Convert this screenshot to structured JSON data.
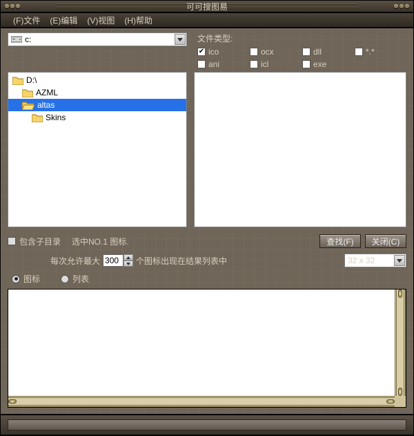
{
  "title": "可可搜图易",
  "menu": {
    "file": "(F)文件",
    "edit": "(E)编辑",
    "view": "(V)视图",
    "help": "(H)帮助"
  },
  "drive": {
    "selected": "c:"
  },
  "filetype": {
    "label": "文件类型:",
    "items": [
      {
        "label": "ico",
        "checked": true
      },
      {
        "label": "ocx",
        "checked": false
      },
      {
        "label": "dll",
        "checked": false
      },
      {
        "label": "*.*",
        "checked": false
      },
      {
        "label": "ani",
        "checked": false
      },
      {
        "label": "icl",
        "checked": false
      },
      {
        "label": "exe",
        "checked": false
      }
    ]
  },
  "tree": {
    "items": [
      {
        "label": "D:\\",
        "indent": 0,
        "open": false,
        "selected": false
      },
      {
        "label": "AZML",
        "indent": 1,
        "open": false,
        "selected": false
      },
      {
        "label": "altas",
        "indent": 1,
        "open": true,
        "selected": true
      },
      {
        "label": "Skins",
        "indent": 2,
        "open": false,
        "selected": false
      }
    ]
  },
  "options": {
    "include_subdirs_label": "包含子目录",
    "include_subdirs_checked": false,
    "select_no1_label": "选中NO.1 图标.",
    "max_prefix": "每次允许最大",
    "max_value": "300",
    "max_suffix": "个图标出现在结果列表中",
    "iconsize_selected": "32 x 32",
    "view_icon_label": "图标",
    "view_list_label": "列表",
    "view_selected": "icon"
  },
  "buttons": {
    "find": "查找(F)",
    "close": "关闭(C)"
  }
}
